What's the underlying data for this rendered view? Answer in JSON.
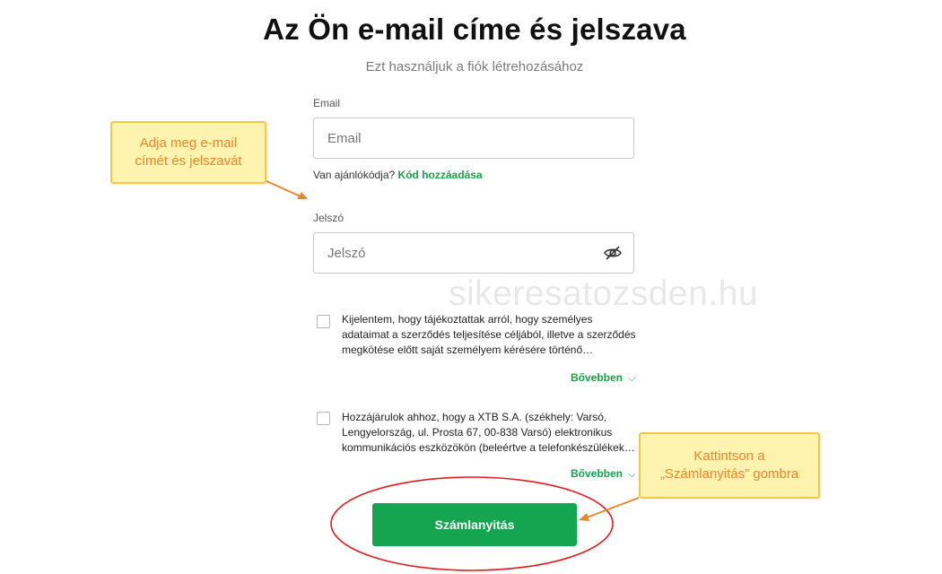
{
  "header": {
    "title": "Az Ön e-mail címe és jelszava",
    "subtitle": "Ezt használjuk a fiók létrehozásához"
  },
  "email": {
    "label": "Email",
    "placeholder": "Email",
    "value": ""
  },
  "referral": {
    "question": "Van ajánlókódja?",
    "link": "Kód hozzáadása"
  },
  "password": {
    "label": "Jelszó",
    "placeholder": "Jelszó",
    "value": "",
    "toggle_icon": "eye-slash-icon"
  },
  "consents": [
    {
      "checked": false,
      "lines": [
        "Kijelentem, hogy tájékoztattak arról, hogy személyes",
        "adataimat a szerződés teljesítése céljából, illetve a szerződés",
        "megkötése előtt saját személyem kérésére történő…"
      ],
      "more": "Bővebben"
    },
    {
      "checked": false,
      "lines": [
        "Hozzájárulok ahhoz, hogy a XTB S.A. (székhely: Varsó,",
        "Lengyelország, ul. Prosta 67, 00-838 Varsó) elektronikus",
        "kommunikációs eszközökön (beleértve a telefonkészülékek…"
      ],
      "more": "Bővebben"
    }
  ],
  "submit_label": "Számlanyitás",
  "watermark": "sikeresatozsden.hu",
  "annotations": {
    "email_callout": [
      "Adja meg e-mail",
      "címét és jelszavát"
    ],
    "button_callout": [
      "Kattintson a",
      "„Számlanyitás” gombra"
    ]
  },
  "colors": {
    "accent_green": "#15a551",
    "callout_fill": "#fff3b0",
    "callout_border": "#f3c842",
    "callout_text": "#e8872b",
    "arrow": "#e8872b",
    "highlight_ellipse": "#e11d1d"
  }
}
